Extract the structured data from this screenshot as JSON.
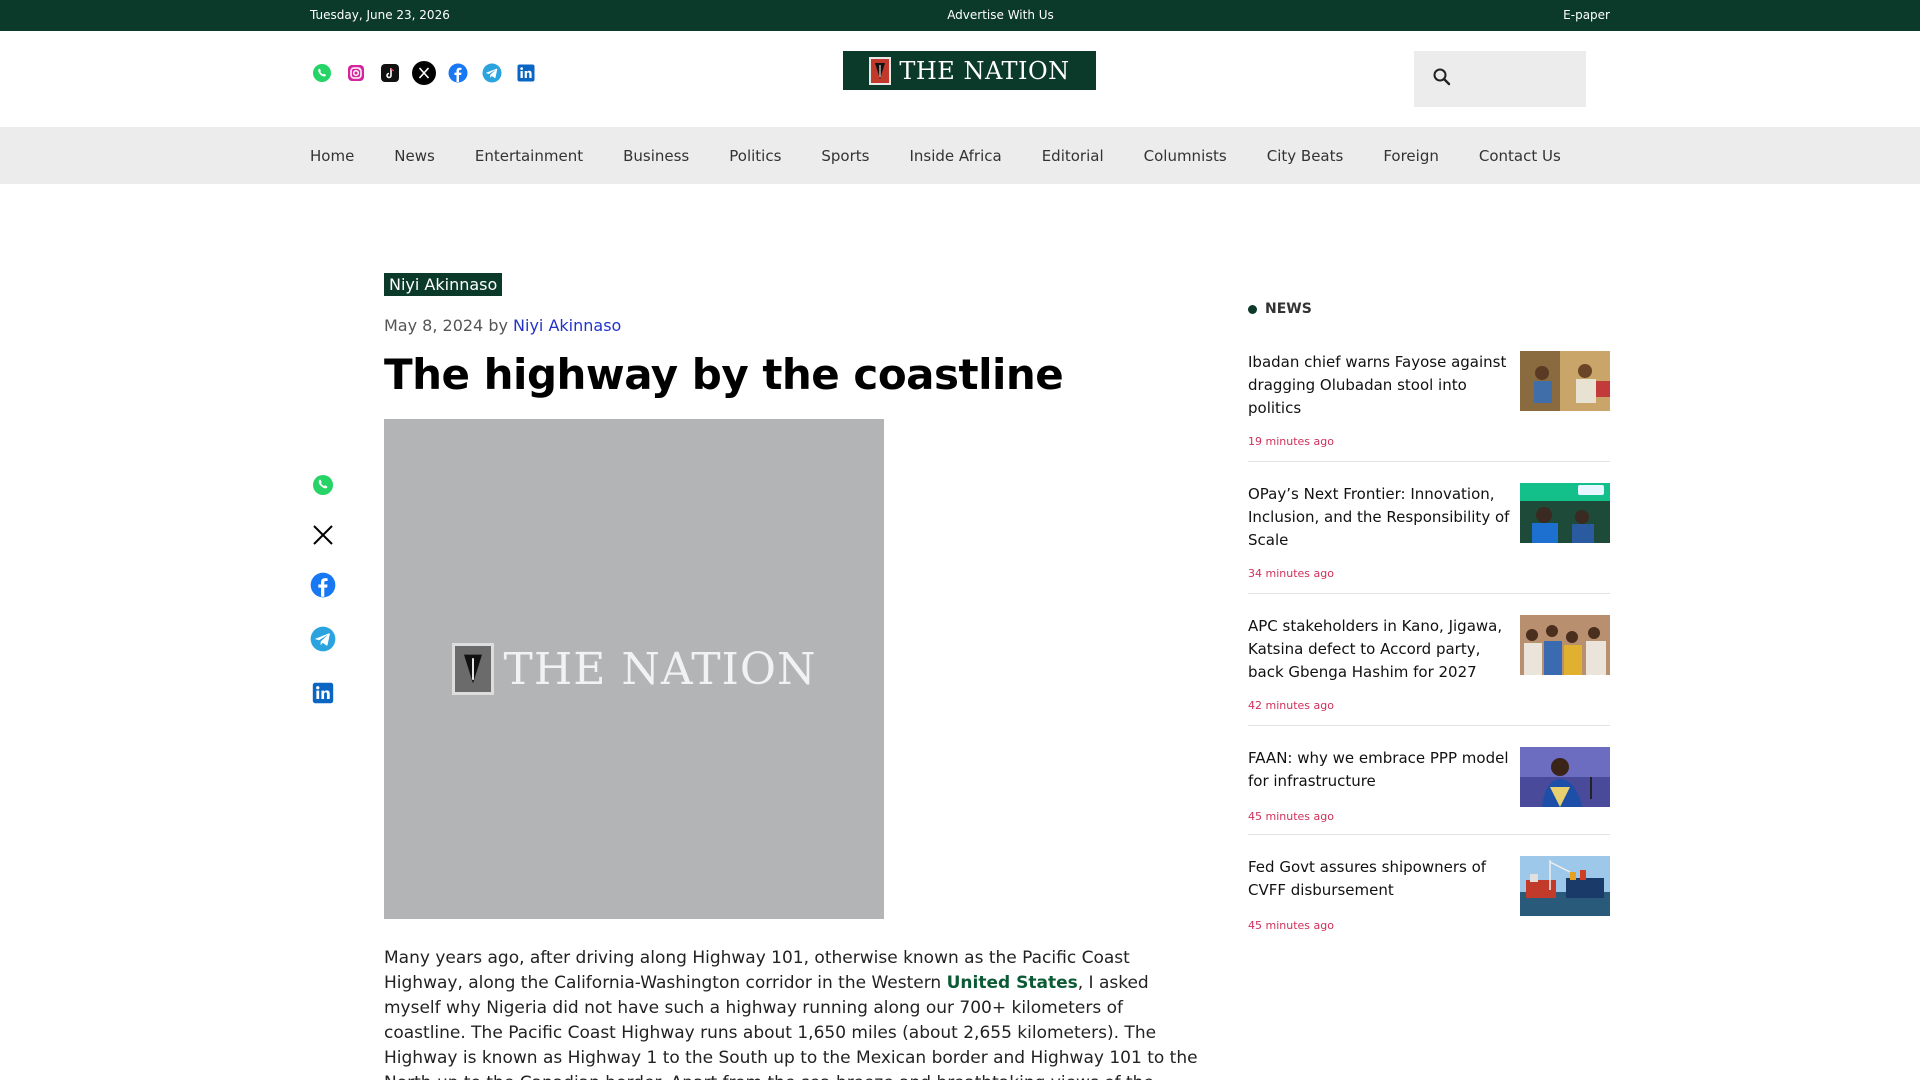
{
  "topbar": {
    "date": "Tuesday, June 23, 2026",
    "advertise": "Advertise With Us",
    "epaper": "E-paper"
  },
  "header": {
    "logo_text": "THE NATION",
    "socials": [
      "whatsapp-icon",
      "instagram-icon",
      "tiktok-icon",
      "x-icon",
      "facebook-icon",
      "telegram-icon",
      "linkedin-icon"
    ]
  },
  "nav": {
    "items": [
      "Home",
      "News",
      "Entertainment",
      "Business",
      "Politics",
      "Sports",
      "Inside Africa",
      "Editorial",
      "Columnists",
      "City Beats",
      "Foreign",
      "Contact Us"
    ]
  },
  "article": {
    "category": "Niyi Akinnaso",
    "date": "May 8, 2024",
    "by": "by",
    "author": "Niyi Akinnaso",
    "title": "The highway by the coastline",
    "hero_logo_text": "THE NATION",
    "body_before": "Many years ago, after driving along Highway 101, otherwise known as the Pacific Coast Highway, along the California-Washington corridor in the Western ",
    "body_link": "United States",
    "body_after": ", I asked myself why Nigeria did not have such a highway running along our 700+ kilometers of coastline. The Pacific Coast Highway runs about 1,650 miles (about 2,655 kilometers). The Highway is known as Highway 1 to the South up to the Mexican border and Highway 101 to the North up to the Canadian border. Apart from the sea breeze and breathtaking views of the Pacific Ocean, where there are tall mountains and many spectacular sceneries along the"
  },
  "share": [
    "whatsapp-icon",
    "x-icon",
    "facebook-icon",
    "telegram-icon",
    "linkedin-icon"
  ],
  "sidebar": {
    "heading": "NEWS",
    "items": [
      {
        "headline": "Ibadan chief warns Fayose against dragging Olubadan stool into politics",
        "time": "19 minutes ago"
      },
      {
        "headline": "OPay’s Next Frontier: Innovation, Inclusion, and the Responsibility of Scale",
        "time": "34 minutes ago"
      },
      {
        "headline": "APC stakeholders in Kano, Jigawa, Katsina defect to Accord party, back Gbenga Hashim for 2027",
        "time": "42 minutes ago"
      },
      {
        "headline": "FAAN: why we embrace PPP model for infrastructure",
        "time": "45 minutes ago"
      },
      {
        "headline": "Fed Govt assures shipowners of CVFF disbursement",
        "time": "45 minutes ago"
      }
    ]
  }
}
